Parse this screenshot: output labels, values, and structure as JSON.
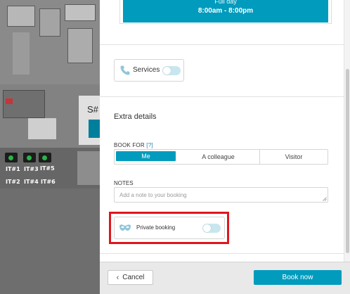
{
  "booking": {
    "fullday_title": "Full day",
    "fullday_time": "8:00am - 8:00pm"
  },
  "services": {
    "label": "Services",
    "icon": "phone-icon",
    "enabled": false
  },
  "extra_details": {
    "title": "Extra details",
    "book_for_label": "BOOK FOR",
    "book_for_help": "[?]",
    "options": [
      "Me",
      "A colleague",
      "Visitor"
    ],
    "selected": "Me",
    "notes_label": "NOTES",
    "notes_placeholder": "Add a note to your booking",
    "notes_value": ""
  },
  "private_booking": {
    "label": "Private booking",
    "icon": "mask-icon",
    "enabled": false
  },
  "footer": {
    "cancel_label": "Cancel",
    "book_label": "Book now"
  },
  "map": {
    "space_label": "S#",
    "desks": [
      "IT#1",
      "IT#3",
      "IT#5",
      "IT#2",
      "IT#4",
      "IT#6"
    ]
  },
  "colors": {
    "accent": "#009bbd",
    "highlight": "#e0161e",
    "toggle_off": "#c9e6ef"
  }
}
